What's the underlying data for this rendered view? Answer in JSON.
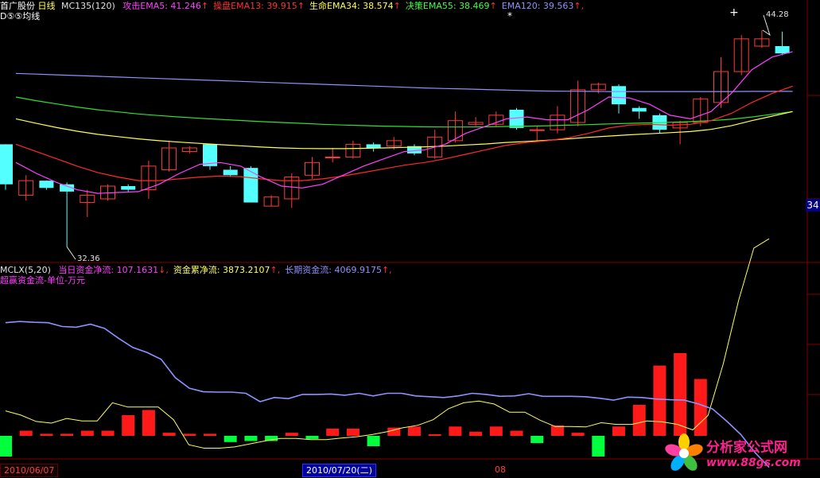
{
  "window": {
    "stock_name": "首广股份",
    "period": "日线",
    "indicator": "MC135(120)",
    "sub_label": "D⑤⑤均线"
  },
  "upper_legend": [
    {
      "label": "攻击EMA5: 41.246",
      "arrow": "↑",
      "color": "#ff40ff"
    },
    {
      "label": "操盘EMA13: 39.915",
      "arrow": "↑",
      "color": "#ff3030"
    },
    {
      "label": "生命EMA34: 38.574",
      "arrow": "↑",
      "color": "#ffff50"
    },
    {
      "label": "决策EMA55: 38.469",
      "arrow": "↑",
      "color": "#40ff40"
    },
    {
      "label": "EMA120: 39.563",
      "arrow": "↑,",
      "color": "#9090ff"
    }
  ],
  "lower_header": {
    "indicator": "MCLX(5,20)",
    "sub_label": "超赢资金流-单位-万元"
  },
  "lower_legend": [
    {
      "label": "当日资金净流: 107.1631",
      "arrow": "↓,",
      "color": "#ff40ff"
    },
    {
      "label": "资金累净流: 3873.2107",
      "arrow": "↑,",
      "color": "#ffff60"
    },
    {
      "label": "长期资金流: 4069.9175",
      "arrow": "↑,",
      "color": "#9090ff"
    }
  ],
  "bottom_axis": {
    "labels": [
      "2010/06/07",
      "2010/07/20(二)",
      "08"
    ]
  },
  "side_value": "34",
  "watermark": {
    "title": "分析家公式网",
    "url": "www.88gs.com"
  },
  "colors": {
    "up": "#ff3b3b",
    "down": "#54ffff",
    "ema5": "#ff40ff",
    "ema13": "#ff2a2a",
    "ema34": "#ffff50",
    "ema55": "#30e030",
    "ema120": "#9090ff",
    "bar_up": "#ff1a1a",
    "bar_down": "#00ff3c",
    "cum": "#ffff60",
    "long": "#9090ff",
    "grid": "#800000"
  },
  "chart_data": [
    {
      "type": "candlestick",
      "title": "",
      "ylim": [
        31.5,
        45.5
      ],
      "max_label": "44.28",
      "min_label": "32.36",
      "candles": [
        {
          "o": 38.0,
          "c": 35.8,
          "h": 38.0,
          "l": 35.5
        },
        {
          "o": 35.2,
          "c": 36.0,
          "h": 36.3,
          "l": 34.9
        },
        {
          "o": 36.0,
          "c": 35.6,
          "h": 36.0,
          "l": 35.5
        },
        {
          "o": 35.8,
          "c": 35.4,
          "h": 35.9,
          "l": 32.36
        },
        {
          "o": 34.8,
          "c": 35.2,
          "h": 35.5,
          "l": 34.0
        },
        {
          "o": 35.0,
          "c": 35.7,
          "h": 35.8,
          "l": 34.9
        },
        {
          "o": 35.7,
          "c": 35.5,
          "h": 35.8,
          "l": 35.4
        },
        {
          "o": 35.5,
          "c": 36.8,
          "h": 37.1,
          "l": 35.0
        },
        {
          "o": 36.6,
          "c": 37.8,
          "h": 38.2,
          "l": 36.5
        },
        {
          "o": 37.6,
          "c": 37.8,
          "h": 37.9,
          "l": 37.5
        },
        {
          "o": 38.0,
          "c": 36.8,
          "h": 38.0,
          "l": 36.6
        },
        {
          "o": 36.6,
          "c": 36.3,
          "h": 36.8,
          "l": 36.2
        },
        {
          "o": 36.7,
          "c": 34.8,
          "h": 36.8,
          "l": 34.8
        },
        {
          "o": 34.6,
          "c": 35.1,
          "h": 35.2,
          "l": 34.6
        },
        {
          "o": 35.0,
          "c": 36.2,
          "h": 36.4,
          "l": 34.5
        },
        {
          "o": 36.3,
          "c": 37.0,
          "h": 37.3,
          "l": 36.1
        },
        {
          "o": 37.3,
          "c": 37.3,
          "h": 37.8,
          "l": 37.0
        },
        {
          "o": 37.3,
          "c": 38.0,
          "h": 38.2,
          "l": 37.2
        },
        {
          "o": 38.0,
          "c": 37.8,
          "h": 38.1,
          "l": 37.6
        },
        {
          "o": 37.9,
          "c": 38.2,
          "h": 38.4,
          "l": 37.7
        },
        {
          "o": 37.9,
          "c": 37.5,
          "h": 38.0,
          "l": 37.4
        },
        {
          "o": 37.3,
          "c": 38.4,
          "h": 38.8,
          "l": 37.2
        },
        {
          "o": 38.2,
          "c": 39.3,
          "h": 39.8,
          "l": 38.1
        },
        {
          "o": 39.1,
          "c": 39.2,
          "h": 39.5,
          "l": 39.0
        },
        {
          "o": 39.1,
          "c": 39.6,
          "h": 39.8,
          "l": 39.0
        },
        {
          "o": 39.9,
          "c": 38.9,
          "h": 40.0,
          "l": 38.8
        },
        {
          "o": 38.8,
          "c": 38.8,
          "h": 39.0,
          "l": 38.2
        },
        {
          "o": 38.8,
          "c": 39.6,
          "h": 40.1,
          "l": 38.6
        },
        {
          "o": 39.2,
          "c": 41.0,
          "h": 41.5,
          "l": 39.0
        },
        {
          "o": 41.0,
          "c": 41.3,
          "h": 41.4,
          "l": 40.8
        },
        {
          "o": 41.2,
          "c": 40.2,
          "h": 41.3,
          "l": 39.7
        },
        {
          "o": 40.0,
          "c": 39.8,
          "h": 40.1,
          "l": 39.4
        },
        {
          "o": 39.6,
          "c": 38.8,
          "h": 39.7,
          "l": 38.6
        },
        {
          "o": 38.9,
          "c": 39.2,
          "h": 39.3,
          "l": 38.0
        },
        {
          "o": 39.2,
          "c": 40.5,
          "h": 40.6,
          "l": 39.0
        },
        {
          "o": 40.3,
          "c": 42.0,
          "h": 42.8,
          "l": 40.0
        },
        {
          "o": 42.0,
          "c": 43.8,
          "h": 44.0,
          "l": 41.8
        },
        {
          "o": 43.4,
          "c": 43.8,
          "h": 44.28,
          "l": 43.3
        },
        {
          "o": 43.4,
          "c": 43.0,
          "h": 44.2,
          "l": 42.9
        }
      ],
      "series": [
        {
          "key": "ema120",
          "values": [
            41.9,
            41.86,
            41.82,
            41.78,
            41.74,
            41.7,
            41.66,
            41.62,
            41.58,
            41.54,
            41.5,
            41.46,
            41.42,
            41.38,
            41.34,
            41.3,
            41.26,
            41.22,
            41.18,
            41.14,
            41.1,
            41.07,
            41.04,
            41.01,
            40.98,
            40.95,
            40.93,
            40.92,
            40.91,
            40.9,
            40.9,
            40.9,
            40.9,
            40.9,
            40.9,
            40.9,
            40.91,
            40.91,
            40.91
          ]
        },
        {
          "key": "ema55",
          "values": [
            40.6,
            40.4,
            40.22,
            40.05,
            39.9,
            39.78,
            39.67,
            39.58,
            39.5,
            39.43,
            39.37,
            39.31,
            39.25,
            39.2,
            39.15,
            39.1,
            39.06,
            39.03,
            39.0,
            38.98,
            38.96,
            38.95,
            38.95,
            38.96,
            38.98,
            39.0,
            39.02,
            39.05,
            39.08,
            39.12,
            39.15,
            39.18,
            39.21,
            39.25,
            39.3,
            39.38,
            39.5,
            39.65,
            39.8
          ]
        },
        {
          "key": "ema34",
          "values": [
            39.4,
            39.15,
            38.92,
            38.72,
            38.55,
            38.42,
            38.3,
            38.2,
            38.12,
            38.05,
            37.98,
            37.92,
            37.85,
            37.8,
            37.77,
            37.76,
            37.76,
            37.78,
            37.8,
            37.83,
            37.86,
            37.9,
            37.96,
            38.02,
            38.1,
            38.16,
            38.22,
            38.3,
            38.38,
            38.45,
            38.52,
            38.58,
            38.64,
            38.7,
            38.82,
            39.02,
            39.3,
            39.55,
            39.8
          ]
        },
        {
          "key": "ema13",
          "values": [
            38.0,
            37.6,
            37.2,
            36.8,
            36.45,
            36.2,
            36.0,
            36.0,
            36.1,
            36.2,
            36.25,
            36.22,
            36.1,
            36.0,
            36.0,
            36.1,
            36.25,
            36.45,
            36.65,
            36.85,
            37.0,
            37.2,
            37.45,
            37.7,
            37.95,
            38.1,
            38.2,
            38.35,
            38.6,
            38.9,
            39.05,
            39.1,
            39.05,
            39.1,
            39.3,
            39.7,
            40.3,
            40.8,
            41.2
          ]
        },
        {
          "key": "ema5",
          "values": [
            37.0,
            36.4,
            35.9,
            35.5,
            35.3,
            35.35,
            35.4,
            35.8,
            36.4,
            36.9,
            37.0,
            36.8,
            36.2,
            35.7,
            35.6,
            35.8,
            36.3,
            36.8,
            37.2,
            37.6,
            37.7,
            38.0,
            38.6,
            39.0,
            39.4,
            39.5,
            39.35,
            39.35,
            39.9,
            40.6,
            40.55,
            40.2,
            39.6,
            39.4,
            39.8,
            40.8,
            42.1,
            42.8,
            43.1
          ]
        }
      ]
    },
    {
      "type": "bar+line",
      "title": "",
      "bars": [
        -20,
        5,
        2,
        2,
        5,
        5,
        20,
        25,
        3,
        2,
        2,
        -6,
        -5,
        -5,
        3,
        -3,
        7,
        7,
        -10,
        8,
        9,
        1,
        9,
        4,
        9,
        5,
        -7,
        10,
        3,
        -20,
        9,
        30,
        68,
        80,
        55
      ],
      "cum": [
        5.9,
        4.9,
        3.4,
        3.0,
        4.1,
        3.5,
        3.5,
        7.8,
        6.8,
        6.8,
        6.8,
        3.8,
        -2.1,
        -2.9,
        -2.9,
        -2.6,
        -1.9,
        -1.2,
        -0.6,
        -0.6,
        -0.9,
        -0.9,
        -0.5,
        -0.2,
        0.3,
        1.0,
        1.9,
        2.5,
        3.8,
        6.4,
        7.8,
        8.2,
        7.5,
        5.6,
        5.6,
        3.7,
        2.2,
        2.2,
        2.1,
        3.1,
        2.7,
        2.7,
        3.5,
        3.3,
        2.7,
        1.4,
        4.8,
        17.0,
        31.9,
        44.3,
        46.5
      ],
      "long": [
        23.4,
        23.7,
        23.5,
        23.4,
        22.4,
        22.2,
        23.0,
        21.9,
        19.3,
        16.9,
        15.6,
        13.8,
        9.0,
        6.2,
        5.3,
        5.2,
        5.2,
        4.9,
        2.7,
        3.8,
        3.5,
        4.6,
        4.6,
        4.7,
        4.4,
        4.9,
        4.2,
        4.9,
        4.9,
        4.2,
        4.0,
        3.8,
        4.2,
        4.9,
        4.6,
        4.1,
        4.2,
        4.8,
        4.1,
        4.1,
        4.1,
        4.0,
        3.6,
        3.1,
        3.9,
        3.8,
        3.4,
        3.2,
        3.1,
        2.1,
        0.8,
        -2.4,
        -5.9,
        -10.6,
        -14.5
      ]
    }
  ]
}
